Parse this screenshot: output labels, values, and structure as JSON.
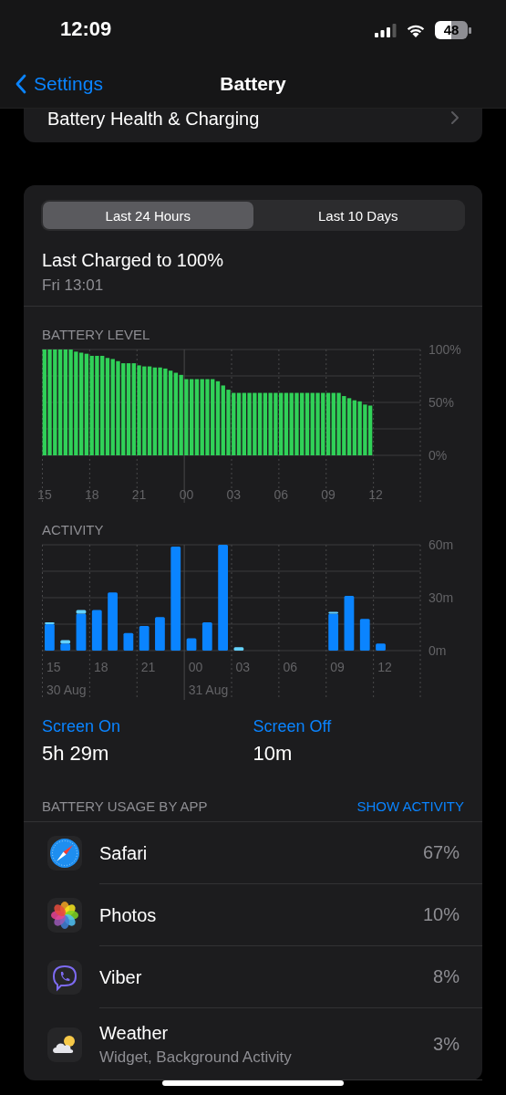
{
  "status_bar": {
    "time": "12:09",
    "battery": "48"
  },
  "nav": {
    "back": "Settings",
    "title": "Battery"
  },
  "health_row": {
    "label": "Battery Health & Charging"
  },
  "tabs": [
    {
      "label": "Last 24 Hours",
      "selected": true
    },
    {
      "label": "Last 10 Days",
      "selected": false
    }
  ],
  "last_charged": {
    "title": "Last Charged to 100%",
    "time": "Fri 13:01"
  },
  "battery_level": {
    "title": "BATTERY LEVEL",
    "chart_data": {
      "type": "bar",
      "color": "#30d158",
      "categories": [
        "15",
        null,
        null,
        null,
        null,
        null,
        null,
        null,
        null,
        "18",
        null,
        null,
        null,
        null,
        null,
        null,
        null,
        null,
        "21",
        null,
        null,
        null,
        null,
        null,
        null,
        null,
        null,
        "00",
        null,
        null,
        null,
        null,
        null,
        null,
        null,
        null,
        "03",
        null,
        null,
        null,
        null,
        null,
        null,
        null,
        null,
        "06",
        null,
        null,
        null,
        null,
        null,
        null,
        null,
        null,
        "09",
        null,
        null,
        null,
        null,
        null,
        null,
        null,
        null,
        "12",
        null,
        null,
        null,
        null,
        null,
        null,
        null,
        null
      ],
      "values": [
        100,
        100,
        100,
        100,
        100,
        100,
        98,
        97,
        96,
        94,
        94,
        94,
        92,
        91,
        89,
        87,
        87,
        87,
        85,
        84,
        84,
        83,
        83,
        82,
        80,
        78,
        76,
        72,
        72,
        72,
        72,
        72,
        72,
        70,
        66,
        62,
        59,
        59,
        59,
        59,
        59,
        59,
        59,
        59,
        59,
        59,
        59,
        59,
        59,
        59,
        59,
        59,
        59,
        59,
        59,
        59,
        59,
        56,
        54,
        52,
        51,
        48,
        47,
        null,
        null,
        null,
        null,
        null,
        null,
        null,
        null,
        null
      ],
      "ylim": [
        0,
        100
      ],
      "yticks": [
        {
          "value": 0,
          "label": "0%"
        },
        {
          "value": 50,
          "label": "50%"
        },
        {
          "value": 100,
          "label": "100%"
        }
      ]
    }
  },
  "activity": {
    "title": "ACTIVITY",
    "chart_data": {
      "type": "bar",
      "stacked": true,
      "categories": [
        "15",
        null,
        null,
        "18",
        null,
        null,
        "21",
        null,
        null,
        "00",
        null,
        null,
        "03",
        null,
        null,
        "06",
        null,
        null,
        "09",
        null,
        null,
        "12",
        null,
        null
      ],
      "series": [
        {
          "color": "#0a84ff",
          "values": [
            15,
            4,
            21,
            23,
            33,
            10,
            14,
            19,
            59,
            7,
            16,
            60,
            0,
            0,
            0,
            0,
            0,
            0,
            21,
            31,
            18,
            4,
            null,
            null
          ]
        },
        {
          "color": "#64d2ff",
          "values": [
            1,
            2,
            2,
            0,
            0,
            0,
            0,
            0,
            0,
            0,
            0,
            0,
            2,
            0,
            0,
            0,
            0,
            0,
            1,
            0,
            0,
            0,
            null,
            null
          ]
        }
      ],
      "ylim": [
        0,
        60
      ],
      "yticks": [
        {
          "value": 0,
          "label": "0m"
        },
        {
          "value": 30,
          "label": "30m"
        },
        {
          "value": 60,
          "label": "60m"
        }
      ],
      "annotations": [
        "30 Aug",
        "31 Aug"
      ]
    }
  },
  "screen_time": [
    {
      "label": "Screen On",
      "value": "5h 29m"
    },
    {
      "label": "Screen Off",
      "value": "10m"
    }
  ],
  "usage": {
    "title": "BATTERY USAGE BY APP",
    "action": "SHOW ACTIVITY",
    "apps": [
      {
        "name": "Safari",
        "percent": "67%"
      },
      {
        "name": "Photos",
        "percent": "10%"
      },
      {
        "name": "Viber",
        "percent": "8%"
      },
      {
        "name": "Weather",
        "detail": "Widget, Background Activity",
        "percent": "3%"
      }
    ]
  }
}
